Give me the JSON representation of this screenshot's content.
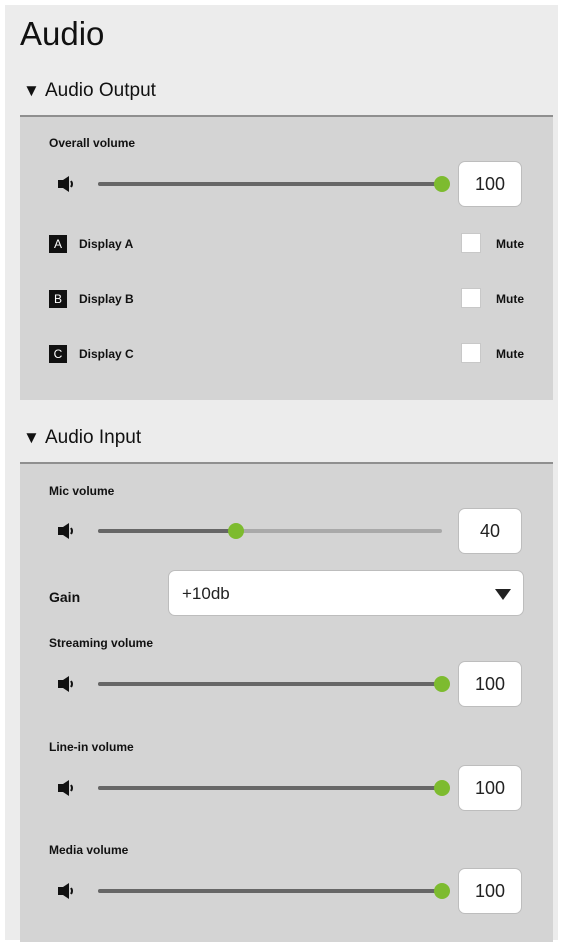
{
  "page": {
    "title": "Audio"
  },
  "output": {
    "header": "Audio Output",
    "overall": {
      "label": "Overall volume",
      "value": "100",
      "level": 1.0
    },
    "displays": [
      {
        "badge": "A",
        "name": "Display A",
        "mute_label": "Mute",
        "muted": false
      },
      {
        "badge": "B",
        "name": "Display B",
        "mute_label": "Mute",
        "muted": false
      },
      {
        "badge": "C",
        "name": "Display C",
        "mute_label": "Mute",
        "muted": false
      }
    ]
  },
  "input": {
    "header": "Audio Input",
    "mic": {
      "label": "Mic volume",
      "value": "40",
      "level": 0.4
    },
    "gain": {
      "label": "Gain",
      "value": "+10db"
    },
    "streaming": {
      "label": "Streaming volume",
      "value": "100",
      "level": 1.0
    },
    "linein": {
      "label": "Line-in volume",
      "value": "100",
      "level": 1.0
    },
    "media": {
      "label": "Media volume",
      "value": "100",
      "level": 1.0
    }
  },
  "colors": {
    "accent": "#7dbb2f",
    "section_bg": "#d4d4d4",
    "page_bg": "#ececec"
  },
  "icons": {
    "section_toggle": "triangle-down-icon",
    "volume": "speaker-icon",
    "select": "dropdown-arrow-icon"
  }
}
